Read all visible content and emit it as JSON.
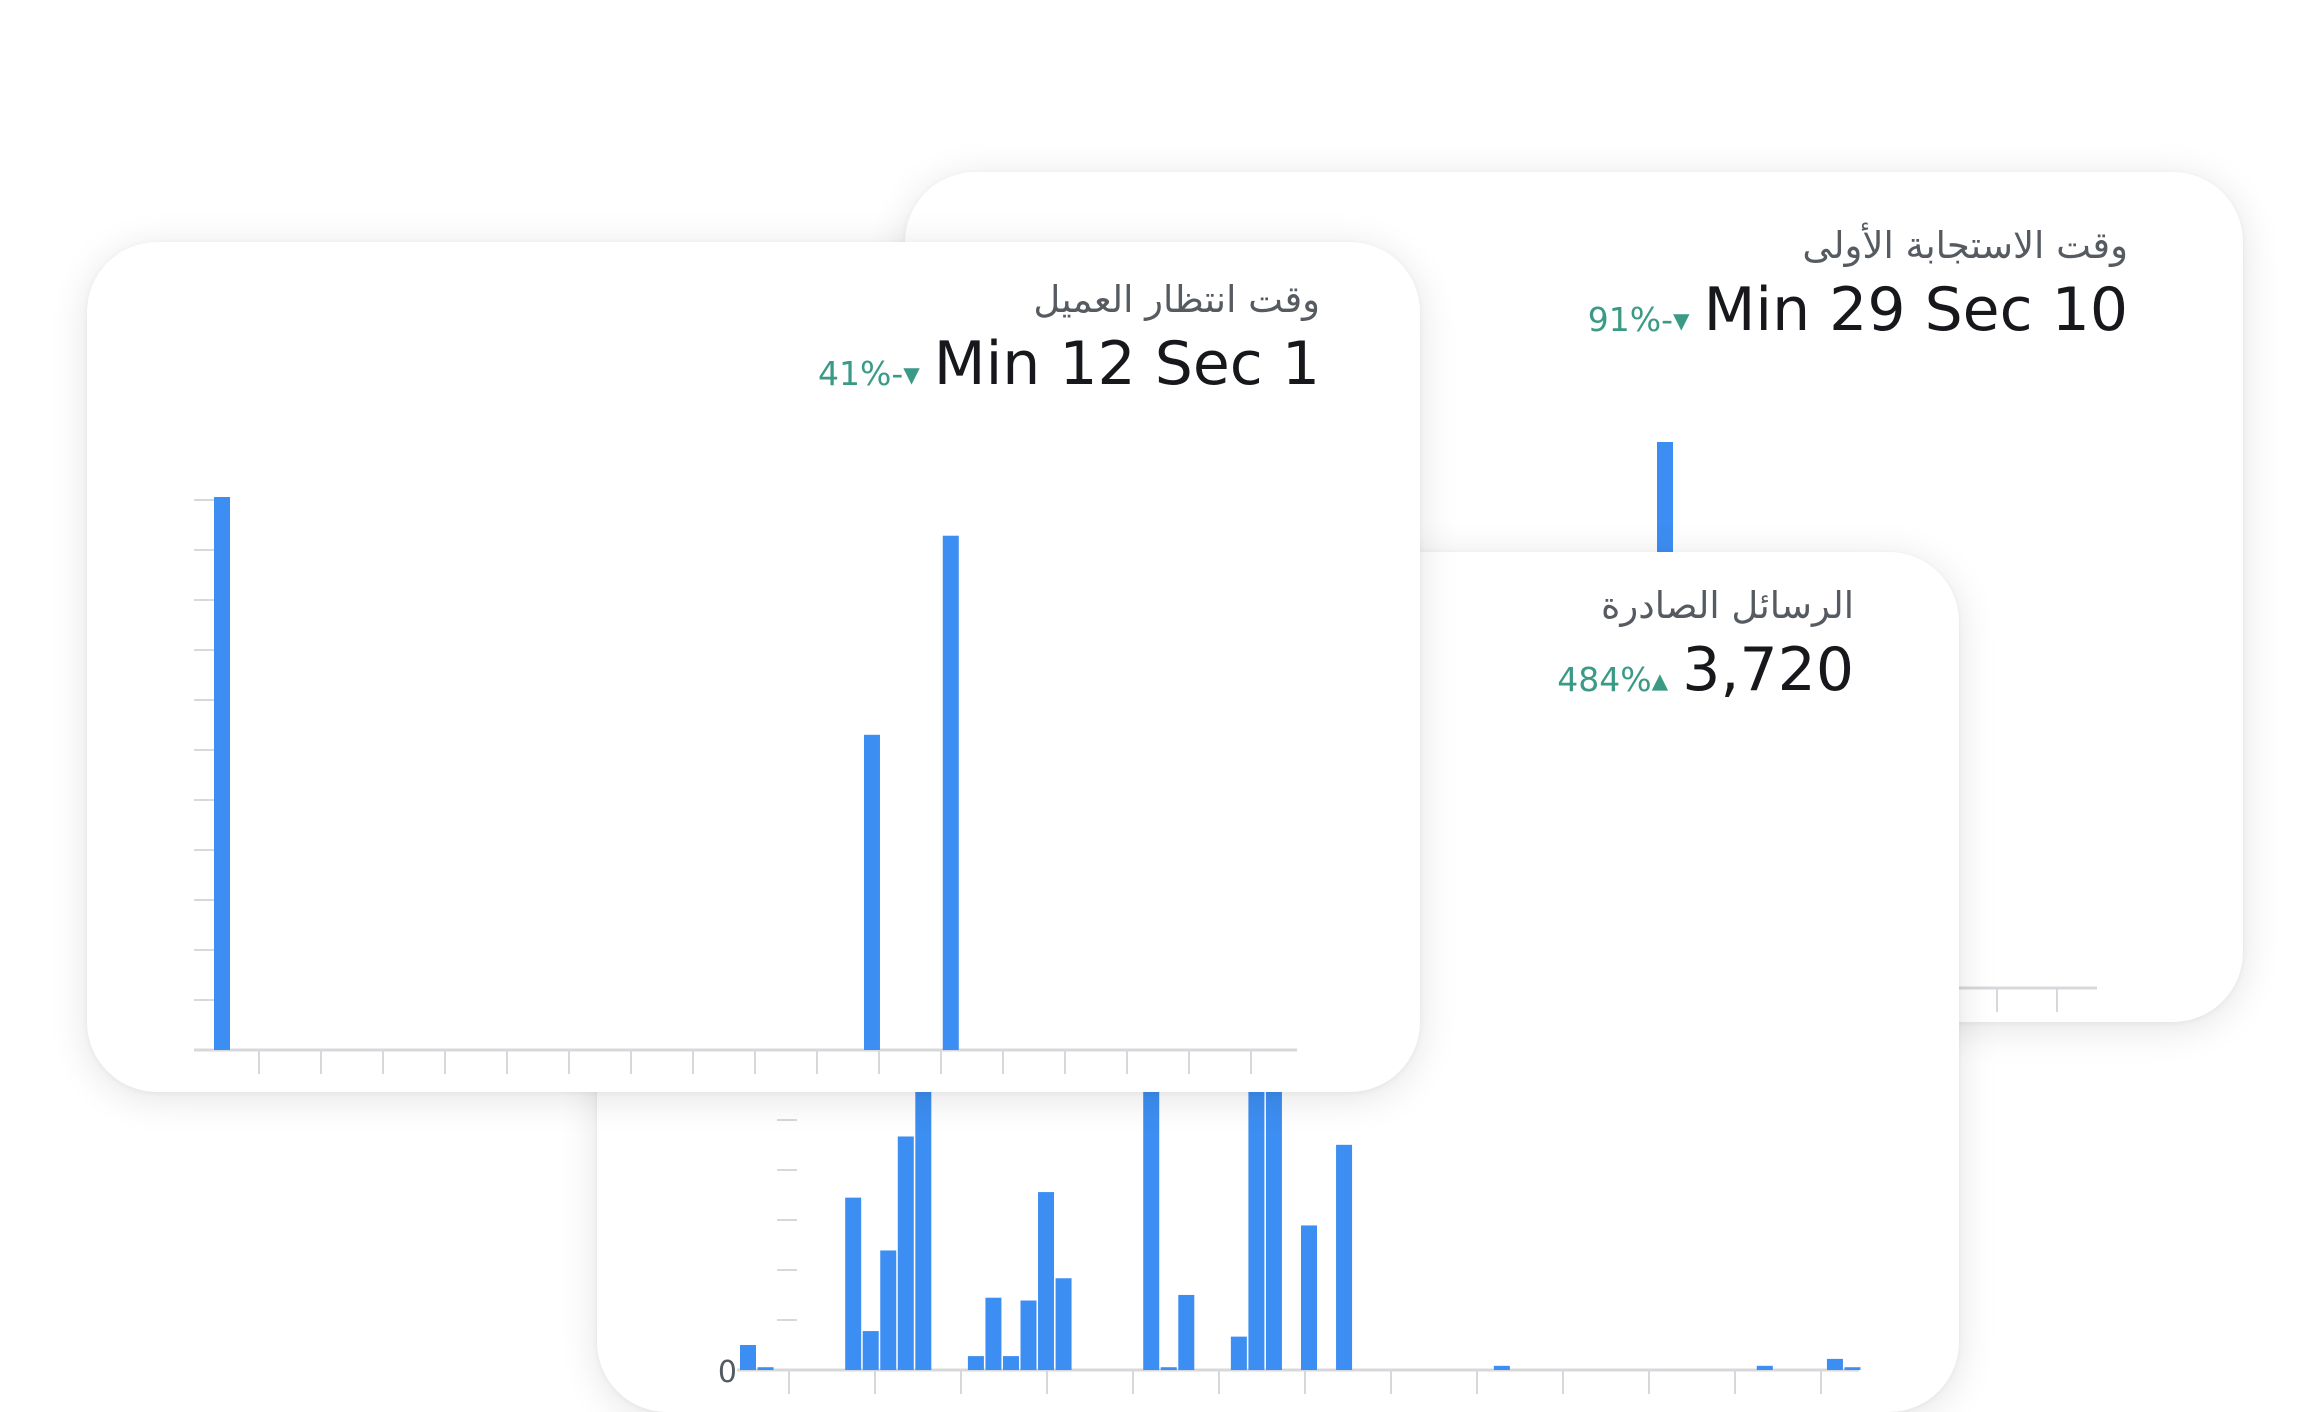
{
  "colors": {
    "bar": "#3d8ef2",
    "axis": "#d6d8db",
    "positive": "#3a9a86"
  },
  "cards": {
    "first_response": {
      "title": "وقت الاستجابة الأولى",
      "value": "Min 29 Sec 10",
      "delta": "91%-▾"
    },
    "outgoing_messages": {
      "title": "الرسائل الصادرة",
      "value": "3,720",
      "delta": "484%▴",
      "y_axis_zero": "0"
    },
    "customer_wait": {
      "title": "وقت انتظار العميل",
      "value": "Min 12 Sec 1",
      "delta": "41%-▾"
    }
  },
  "chart_data": [
    {
      "type": "bar",
      "name": "first_response",
      "values_visible_fraction": [
        1.0
      ],
      "note_visible_bar_index": 0
    },
    {
      "type": "bar",
      "name": "outgoing_messages",
      "ylim_visible": [
        0,
        1
      ],
      "values": [
        0.09,
        0.01,
        0,
        0,
        0,
        0,
        0.62,
        0.14,
        0.43,
        0.84,
        1.0,
        0,
        0,
        0.05,
        0.26,
        0.05,
        0.25,
        0.64,
        0.33,
        0,
        0,
        0,
        0,
        1.0,
        0.01,
        0.27,
        0,
        0,
        0.12,
        1.0,
        1.0,
        0,
        0.52,
        0,
        0.81,
        0,
        0,
        0,
        0,
        0,
        0,
        0,
        0,
        0.015,
        0,
        0,
        0,
        0,
        0,
        0,
        0,
        0,
        0,
        0,
        0,
        0,
        0,
        0,
        0.015,
        0,
        0,
        0,
        0.04,
        0.01
      ]
    },
    {
      "type": "bar",
      "name": "customer_wait",
      "ylim": [
        0,
        1
      ],
      "values": [
        1.0,
        0,
        0,
        0,
        0,
        0,
        0,
        0,
        0,
        0,
        0,
        0,
        0,
        0,
        0,
        0,
        0,
        0,
        0,
        0,
        0,
        0,
        0,
        0,
        0,
        0,
        0,
        0,
        0,
        0,
        0,
        0,
        0,
        0.57,
        0,
        0,
        0,
        0.93,
        0,
        0,
        0,
        0,
        0,
        0,
        0,
        0,
        0,
        0,
        0,
        0,
        0,
        0,
        0,
        0,
        0,
        0
      ]
    }
  ]
}
